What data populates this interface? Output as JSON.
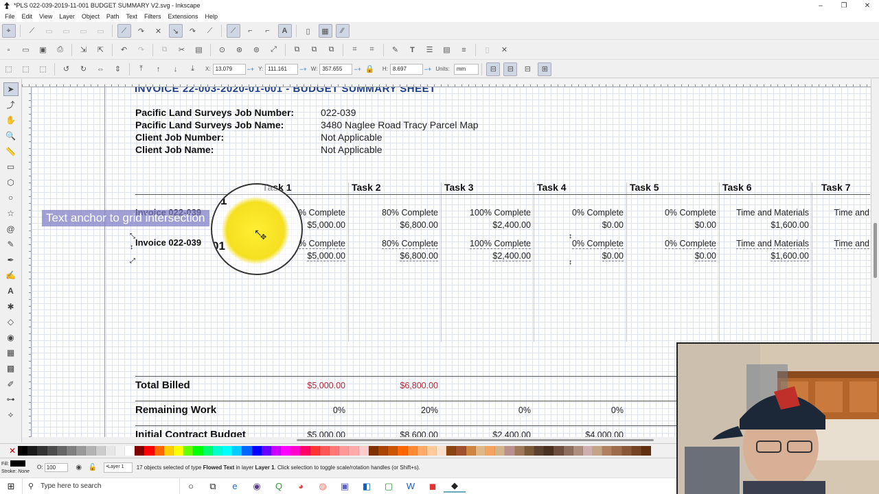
{
  "window": {
    "title": "*PLS 022-039-2019-11-001 BUDGET SUMMARY V2.svg - Inkscape",
    "controls": [
      "–",
      "❐",
      "✕"
    ]
  },
  "menu": [
    "File",
    "Edit",
    "View",
    "Layer",
    "Object",
    "Path",
    "Text",
    "Filters",
    "Extensions",
    "Help"
  ],
  "toolbar1": [
    "node-tool-icon",
    "snap-icon",
    "snap-bbox-icon",
    "snap-bbox-edge-icon",
    "snap-bbox-corner-icon",
    "snap-bbox-mid-icon",
    "snap-nodes-icon",
    "snap-path-icon",
    "snap-cusp-icon",
    "snap-smooth-icon",
    "snap-intersection-icon",
    "snap-guide-icon",
    "snap-midpoint-icon",
    "snap-text-anchor-icon",
    "snap-page-icon",
    "snap-grid-icon",
    "snap-guides-icon"
  ],
  "tool_controls": {
    "x_label": "X:",
    "x": "13.079",
    "y_label": "Y:",
    "y": "111.161",
    "w_label": "W:",
    "w": "357.655",
    "h_label": "H:",
    "h": "8.697",
    "units_label": "Units:",
    "units": "mm"
  },
  "document": {
    "title": "INVOICE 22-003-2020-01-001 - BUDGET SUMMARY SHEET",
    "info": [
      {
        "label": "Pacific Land Surveys Job Number:",
        "value": "022-039"
      },
      {
        "label": "Pacific Land Surveys Job Name:",
        "value": "3480 Naglee Road Tracy Parcel Map"
      },
      {
        "label": "Client Job Number:",
        "value": "Not Applicable"
      },
      {
        "label": "Client Job Name:",
        "value": "Not Applicable"
      }
    ],
    "tasks": [
      "Task 1",
      "Task 2",
      "Task 3",
      "Task 4",
      "Task 5",
      "Task 6",
      "Task 7"
    ],
    "rows": [
      {
        "label": "Invoice 022-039",
        "cells": [
          {
            "status": "% Complete",
            "amount": "$5,000.00"
          },
          {
            "status": "80% Complete",
            "amount": "$6,800.00"
          },
          {
            "status": "100% Complete",
            "amount": "$2,400.00"
          },
          {
            "status": "0% Complete",
            "amount": "$0.00"
          },
          {
            "status": "0% Complete",
            "amount": "$0.00"
          },
          {
            "status": "Time and Materials",
            "amount": "$1,600.00"
          },
          {
            "status": "Time and",
            "amount": ""
          }
        ]
      },
      {
        "label": "Invoice 022-039",
        "cells": [
          {
            "status": "% Complete",
            "amount": "$5,000.00"
          },
          {
            "status": "80% Complete",
            "amount": "$6,800.00"
          },
          {
            "status": "100% Complete",
            "amount": "$2,400.00"
          },
          {
            "status": "0% Complete",
            "amount": "$0.00"
          },
          {
            "status": "0% Complete",
            "amount": "$0.00"
          },
          {
            "status": "Time and Materials",
            "amount": "$1,600.00"
          },
          {
            "status": "Time and",
            "amount": ""
          }
        ]
      }
    ],
    "totals": [
      {
        "label": "Total Billed",
        "values": [
          "$5,000.00",
          "$6,800.00"
        ]
      },
      {
        "label": "Remaining Work",
        "values": [
          "0%",
          "20%",
          "0%",
          "0%"
        ]
      },
      {
        "label": "Initial Contract Budget",
        "values": [
          "$5,000.00",
          "$8,600.00",
          "$2,400.00",
          "$4,000.00"
        ]
      }
    ],
    "tooltip": "Text anchor to grid intersection",
    "magnifier_digits": [
      "1",
      "01"
    ]
  },
  "palette": [
    "#000000",
    "#1a1a1a",
    "#333333",
    "#4d4d4d",
    "#666666",
    "#808080",
    "#999999",
    "#b3b3b3",
    "#cccccc",
    "#e6e6e6",
    "#f2f2f2",
    "#ffffff",
    "#800000",
    "#ff0000",
    "#ff6600",
    "#ffcc00",
    "#ffff00",
    "#66ff00",
    "#00ff00",
    "#00ff66",
    "#00ffcc",
    "#00ffff",
    "#00ccff",
    "#0066ff",
    "#0000ff",
    "#6600ff",
    "#cc00ff",
    "#ff00ff",
    "#ff00cc",
    "#ff0066",
    "#ff3333",
    "#ff5555",
    "#ff7777",
    "#ff9999",
    "#ffaaaa",
    "#ffcccc",
    "#803300",
    "#aa4400",
    "#cc5500",
    "#ff6600",
    "#ff8833",
    "#ffaa66",
    "#ffcc99",
    "#ffe0cc",
    "#8b4513",
    "#a0522d",
    "#cd853f",
    "#deb887",
    "#f4a460",
    "#d2b48c",
    "#bc8f8f",
    "#a0785a",
    "#7a5a3a",
    "#5c4030",
    "#4a3020",
    "#6e4e3e",
    "#8e6e5e",
    "#ae8e7e",
    "#ceaeae",
    "#c4a484",
    "#b08060",
    "#9c6c4c",
    "#885838",
    "#744424",
    "#603010"
  ],
  "status": {
    "fill_label": "Fill:",
    "stroke_label": "Stroke:",
    "stroke_value": "None",
    "opacity_label": "O:",
    "opacity": "100",
    "layer": "•Layer 1",
    "message_prefix": "17 objects selected of type ",
    "message_type": "Flowed Text",
    "message_mid": " in layer ",
    "message_layer": "Layer 1",
    "message_suffix": ". Click selection to toggle scale/rotation handles (or Shift+s)."
  },
  "taskbar": {
    "search_placeholder": "Type here to search",
    "apps": [
      "cortana-icon",
      "task-view-icon",
      "edge-icon",
      "app-icon",
      "qgis-icon",
      "chrome-icon",
      "firefox-icon",
      "teams-icon",
      "outlook-icon",
      "camtasia-icon",
      "word-icon",
      "app-red-icon",
      "inkscape-icon"
    ]
  }
}
